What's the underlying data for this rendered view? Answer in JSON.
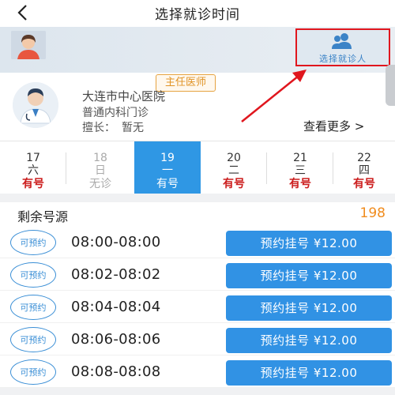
{
  "header": {
    "title": "选择就诊时间"
  },
  "patient": {
    "select_label": "选择就诊人"
  },
  "doctor": {
    "title_badge": "主任医师",
    "hospital": "大连市中心医院",
    "department": "普通内科门诊",
    "specialty_label": "擅长：",
    "specialty_value": "暂无",
    "more_label": "查看更多 >"
  },
  "dates": [
    {
      "day": "17",
      "weekday": "六",
      "status": "有号"
    },
    {
      "day": "18",
      "weekday": "日",
      "status": "无诊"
    },
    {
      "day": "19",
      "weekday": "一",
      "status": "有号"
    },
    {
      "day": "20",
      "weekday": "二",
      "status": "有号"
    },
    {
      "day": "21",
      "weekday": "三",
      "status": "有号"
    },
    {
      "day": "22",
      "weekday": "四",
      "status": "有号"
    }
  ],
  "remaining": {
    "label": "剩余号源",
    "count": "198"
  },
  "slots": [
    {
      "stamp": "可预约",
      "time": "08:00-08:00",
      "button": "预约挂号 ¥12.00"
    },
    {
      "stamp": "可预约",
      "time": "08:02-08:02",
      "button": "预约挂号 ¥12.00"
    },
    {
      "stamp": "可预约",
      "time": "08:04-08:04",
      "button": "预约挂号 ¥12.00"
    },
    {
      "stamp": "可预约",
      "time": "08:06-08:06",
      "button": "预约挂号 ¥12.00"
    },
    {
      "stamp": "可预约",
      "time": "08:08-08:08",
      "button": "预约挂号 ¥12.00"
    }
  ],
  "colors": {
    "accent": "#3192e4",
    "alert": "#e0161e",
    "count": "#f08c1e"
  },
  "icons": [
    "back-icon",
    "patient-avatar-icon",
    "user-group-icon",
    "doctor-avatar-icon",
    "red-arrow-icon"
  ]
}
